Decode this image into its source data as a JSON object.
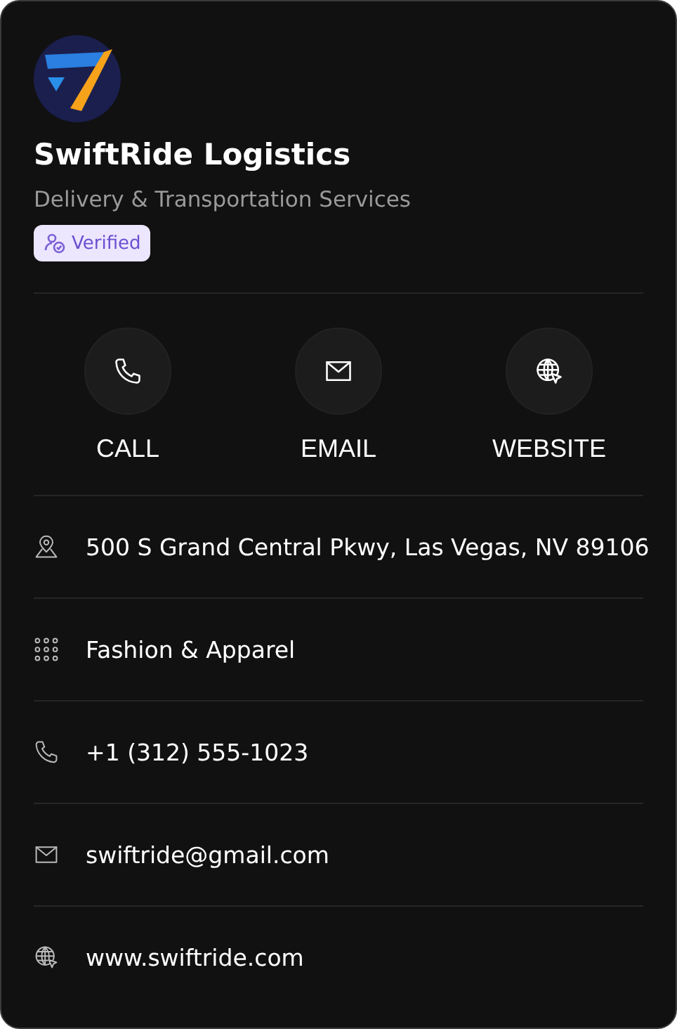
{
  "company": {
    "name": "SwiftRide Logistics",
    "tagline": "Delivery & Transportation Services",
    "badge": "Verified"
  },
  "actions": [
    {
      "kind": "phone",
      "label": "CALL"
    },
    {
      "kind": "email",
      "label": "EMAIL"
    },
    {
      "kind": "web",
      "label": "WEBSITE"
    }
  ],
  "details": [
    {
      "kind": "location",
      "text": "500 S Grand Central Pkwy, Las Vegas, NV 89106"
    },
    {
      "kind": "category",
      "text": "Fashion & Apparel"
    },
    {
      "kind": "phone",
      "text": "+1 (312) 555-1023"
    },
    {
      "kind": "email",
      "text": "swiftride@gmail.com"
    },
    {
      "kind": "web",
      "text": "www.swiftride.com"
    }
  ]
}
